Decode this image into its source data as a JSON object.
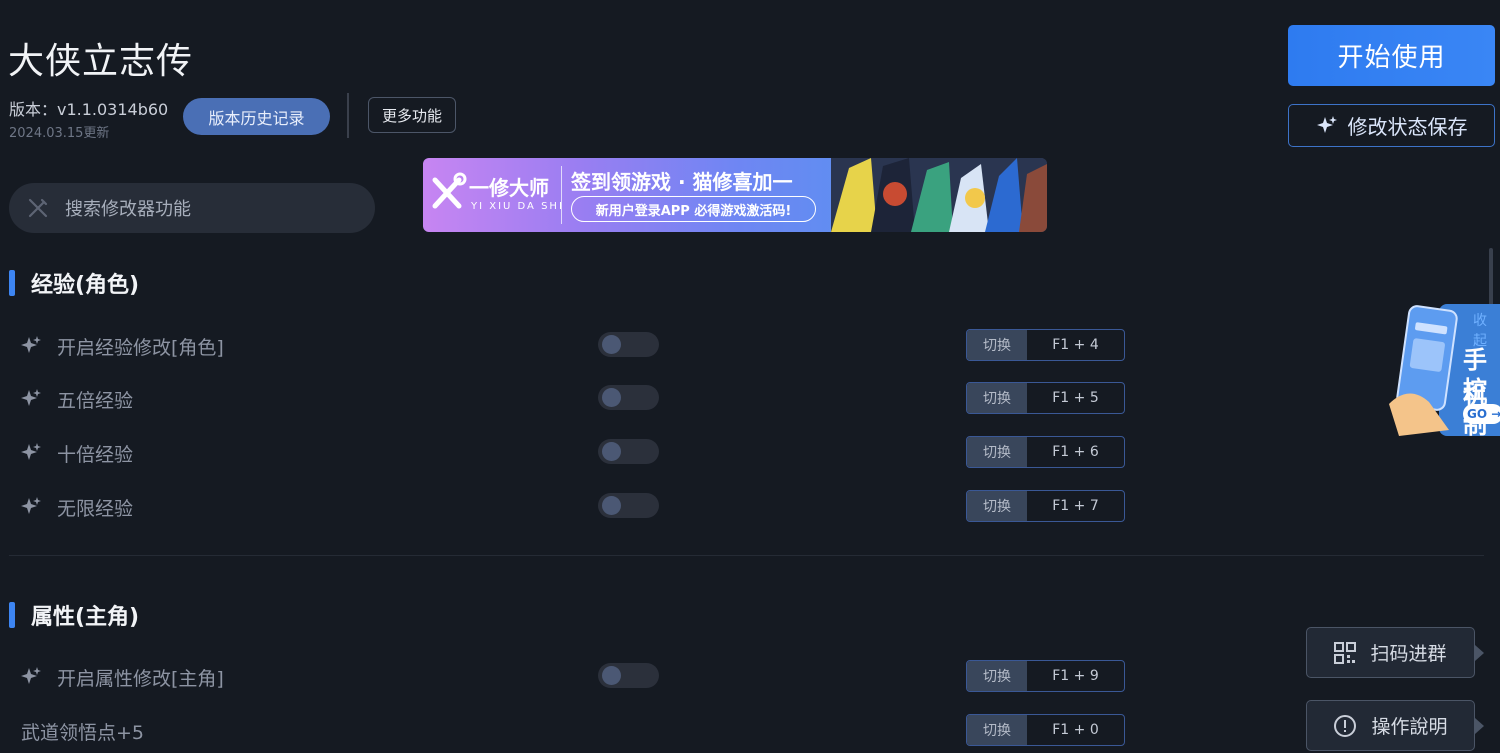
{
  "header": {
    "title": "大侠立志传",
    "version": "版本：v1.1.0314b60",
    "update_date": "2024.03.15更新",
    "history_button": "版本历史记录",
    "more_button": "更多功能"
  },
  "search": {
    "placeholder": "搜索修改器功能"
  },
  "banner": {
    "brand": "一修大师",
    "brand_sub": "YI XIU DA SHI",
    "headline": "签到领游戏 · 猫修喜加一",
    "pill": "新用户登录APP  必得游戏激活码!"
  },
  "actions": {
    "start_button": "开始使用",
    "save_state_button": "修改状态保存"
  },
  "sections": [
    {
      "title": "经验(角色)",
      "rows": [
        {
          "label": "开启经验修改[角色]",
          "hotkey_label": "切换",
          "hotkey": "F1 + 4"
        },
        {
          "label": "五倍经验",
          "hotkey_label": "切换",
          "hotkey": "F1 + 5"
        },
        {
          "label": "十倍经验",
          "hotkey_label": "切换",
          "hotkey": "F1 + 6"
        },
        {
          "label": "无限经验",
          "hotkey_label": "切换",
          "hotkey": "F1 + 7"
        }
      ]
    },
    {
      "title": "属性(主角)",
      "rows": [
        {
          "label": "开启属性修改[主角]",
          "hotkey_label": "切换",
          "hotkey": "F1 + 9"
        },
        {
          "label": "武道领悟点+5",
          "hotkey_label": "切换",
          "hotkey": "F1 + 0"
        }
      ]
    }
  ],
  "side_widget": {
    "collect": "收起",
    "line1": "手机",
    "line2": "控制",
    "go": "GO →"
  },
  "side_buttons": {
    "scan_group": "扫码进群",
    "instructions": "操作說明"
  },
  "colors": {
    "background": "#151a22",
    "accent": "#2e7bf0",
    "section_bar": "#3d85f2"
  }
}
